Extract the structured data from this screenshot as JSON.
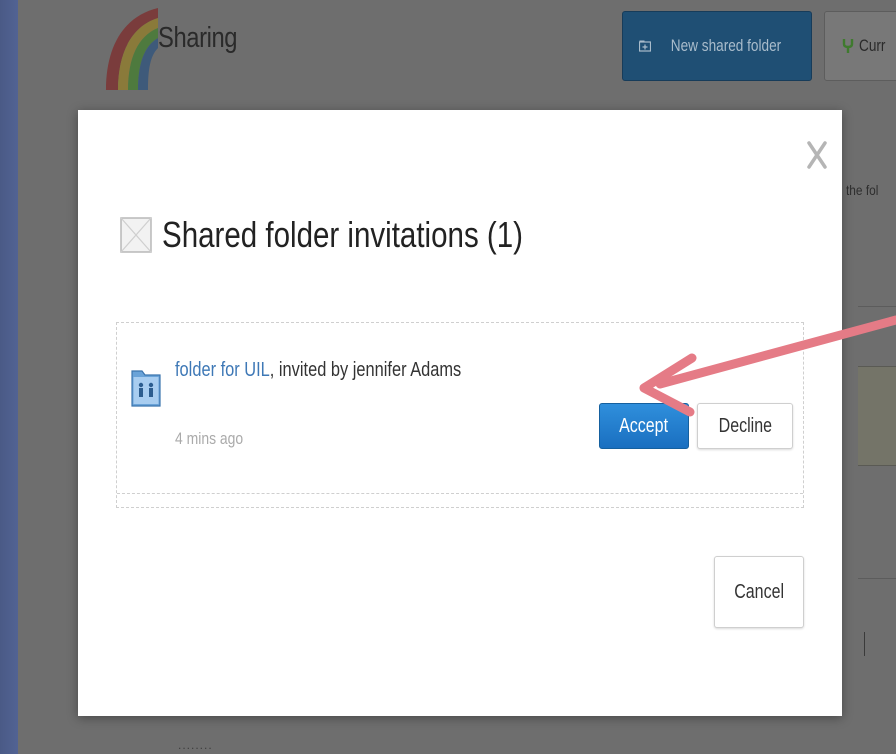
{
  "app": {
    "title": "Sharing",
    "new_shared_folder_label": "New shared folder",
    "current_button_label": "Curr",
    "background_text": "the fol",
    "bottom_text": "........"
  },
  "modal": {
    "title": "Shared folder invitations (1)",
    "invitation": {
      "folder_name": "folder for UIL",
      "invited_text": ", invited by jennifer Adams",
      "time": "4 mins ago",
      "accept_label": "Accept",
      "decline_label": "Decline"
    },
    "cancel_label": "Cancel"
  },
  "icons": [
    "rainbow-logo-icon",
    "folder-plus-icon",
    "branch-icon",
    "close-icon",
    "envelope-icon",
    "shared-folder-icon",
    "annotation-arrow"
  ],
  "colors": {
    "accent": "#2a85d3",
    "link": "#3e78b6",
    "annotation_arrow": "#e57b86"
  }
}
